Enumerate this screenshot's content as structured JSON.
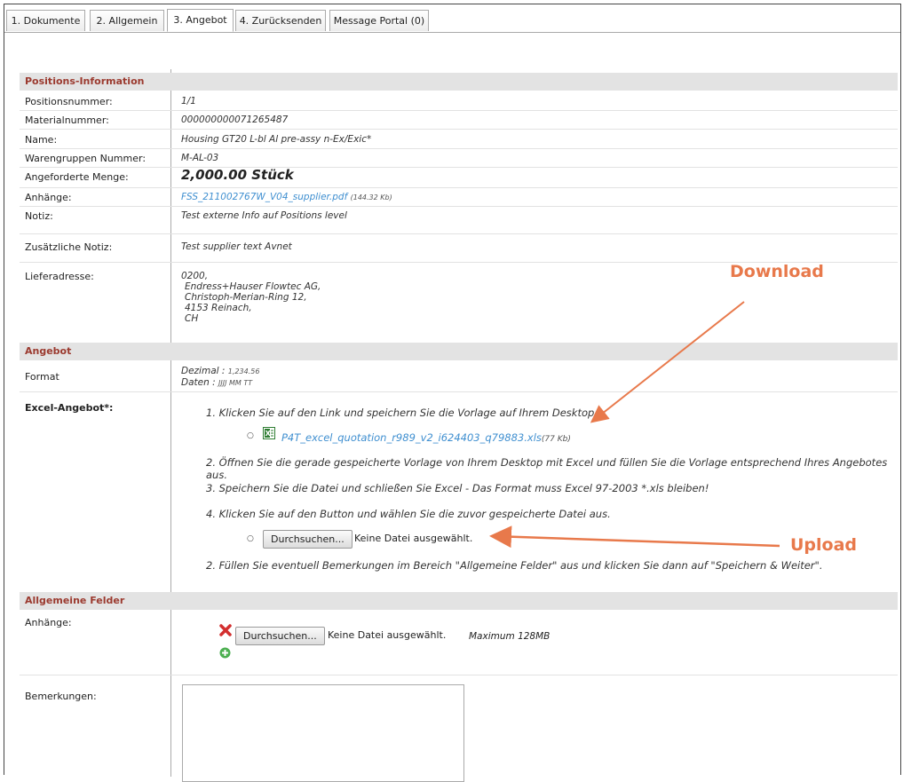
{
  "tabs": [
    "1. Dokumente",
    "2. Allgemein",
    "3. Angebot",
    "4. Zurücksenden",
    "Message Portal (0)"
  ],
  "sections": {
    "positions": "Positions-Information",
    "angebot": "Angebot",
    "allgemein": "Allgemeine Felder"
  },
  "positions": [
    {
      "label": "Positionsnummer:",
      "value": "1/1"
    },
    {
      "label": "Materialnummer:",
      "value": "000000000071265487"
    },
    {
      "label": "Name:",
      "value": "Housing GT20 L-bl Al pre-assy n-Ex/Exic*"
    },
    {
      "label": "Warengruppen Nummer:",
      "value": "M-AL-03"
    },
    {
      "label": "Angeforderte Menge:",
      "value": "2,000.00 Stück"
    },
    {
      "label": "Anhänge:",
      "value": "FSS_211002767W_V04_supplier.pdf",
      "size": "(144.32 Kb)"
    },
    {
      "label": "Notiz:",
      "value": "Test externe Info auf Positions level"
    },
    {
      "label": "Zusätzliche Notiz:",
      "value": "Test supplier text Avnet"
    },
    {
      "label": "Lieferadresse:",
      "value": [
        "0200,",
        "Endress+Hauser Flowtec AG,",
        "Christoph-Merian-Ring 12,",
        "4153 Reinach,",
        "CH"
      ]
    }
  ],
  "format": {
    "label": "Format",
    "dezimal_label": "Dezimal :",
    "dezimal_value": "1,234.56",
    "daten_label": "Daten :",
    "daten_value": "JJJJ MM TT"
  },
  "excel": {
    "label": "Excel-Angebot*:",
    "step1": "1.  Klicken Sie auf den Link und speichern Sie die Vorlage auf Ihrem Desktop.",
    "file_link": "P4T_excel_quotation_r989_v2_i624403_q79883.xls",
    "file_size": "(77 Kb)",
    "step2": "2.  Öffnen Sie die gerade gespeicherte Vorlage von Ihrem Desktop mit Excel und füllen Sie die Vorlage entsprechend Ihres Angebotes aus.",
    "step3": "3.  Speichern Sie die Datei und schließen Sie Excel - Das Format muss Excel 97-2003 *.xls bleiben!",
    "step4": "4.  Klicken Sie auf den Button und wählen Sie die zuvor gespeicherte Datei aus.",
    "browse": "Durchsuchen...",
    "no_file": "Keine Datei ausgewählt.",
    "step5": "2.  Füllen Sie eventuell Bemerkungen im Bereich \"Allgemeine Felder\" aus und klicken Sie dann auf \"Speichern & Weiter\"."
  },
  "allgemein": {
    "anhaenge_label": "Anhänge:",
    "browse": "Durchsuchen...",
    "no_file": "Keine Datei ausgewählt.",
    "max": "Maximum 128MB",
    "bemerkungen_label": "Bemerkungen:"
  },
  "annotations": {
    "download": "Download",
    "upload": "Upload"
  },
  "colors": {
    "section_text": "#9b3a2f",
    "link": "#3f8fd0",
    "annotation": "#e8794b"
  }
}
